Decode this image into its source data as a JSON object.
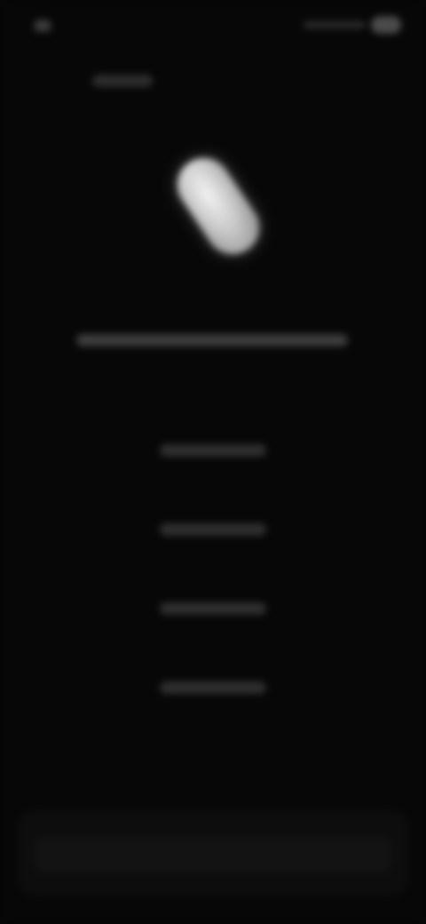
{
  "status_bar": {
    "time": ""
  },
  "navigation": {
    "back_label": ""
  },
  "hero": {
    "icon": "capsule-icon",
    "icon_color": "#e6e6e6"
  },
  "headline": {
    "text": ""
  },
  "options": [
    {
      "label": ""
    },
    {
      "label": ""
    },
    {
      "label": ""
    },
    {
      "label": ""
    }
  ],
  "bottom_panel": {
    "text": ""
  },
  "colors": {
    "background": "#070707",
    "text_muted": "#3c3c3c"
  }
}
